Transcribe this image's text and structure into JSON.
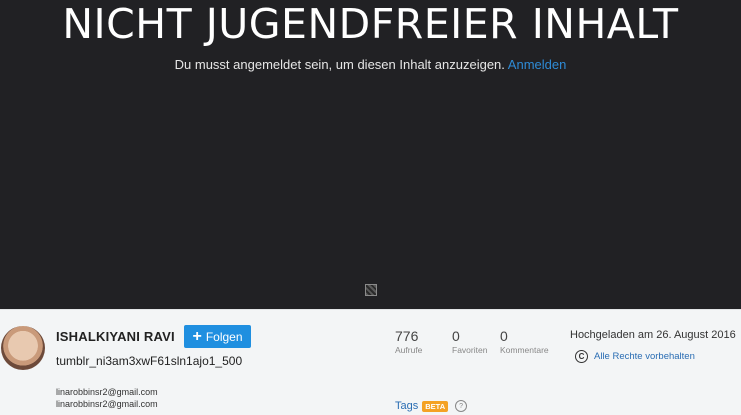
{
  "gate": {
    "headline": "NICHT JUGENDFREIER INHALT",
    "message": "Du musst angemeldet sein, um diesen Inhalt anzuzeigen.",
    "login_link": "Anmelden"
  },
  "owner": {
    "name": "ISHALKIYANI RAVI",
    "follow_label": "Folgen",
    "emails": [
      "linarobbinsr2@gmail.com",
      "linarobbinsr2@gmail.com"
    ]
  },
  "photo": {
    "title": "tumblr_ni3am3xwF61sln1ajo1_500"
  },
  "stats": {
    "views": {
      "value": "776",
      "label": "Aufrufe"
    },
    "faves": {
      "value": "0",
      "label": "Favoriten"
    },
    "comments": {
      "value": "0",
      "label": "Kommentare"
    }
  },
  "meta": {
    "uploaded": "Hochgeladen am 26. August 2016",
    "rights": "Alle Rechte vorbehalten"
  },
  "tags": {
    "label": "Tags",
    "badge": "BETA"
  },
  "icons": {
    "follow": "plus-icon",
    "copyright": "copyright-icon",
    "help": "help-icon",
    "broken_image": "broken-image-icon"
  },
  "colors": {
    "stage_bg": "#212124",
    "accent": "#1f8fe0",
    "link": "#2e8bd6",
    "beta": "#f4a224"
  }
}
